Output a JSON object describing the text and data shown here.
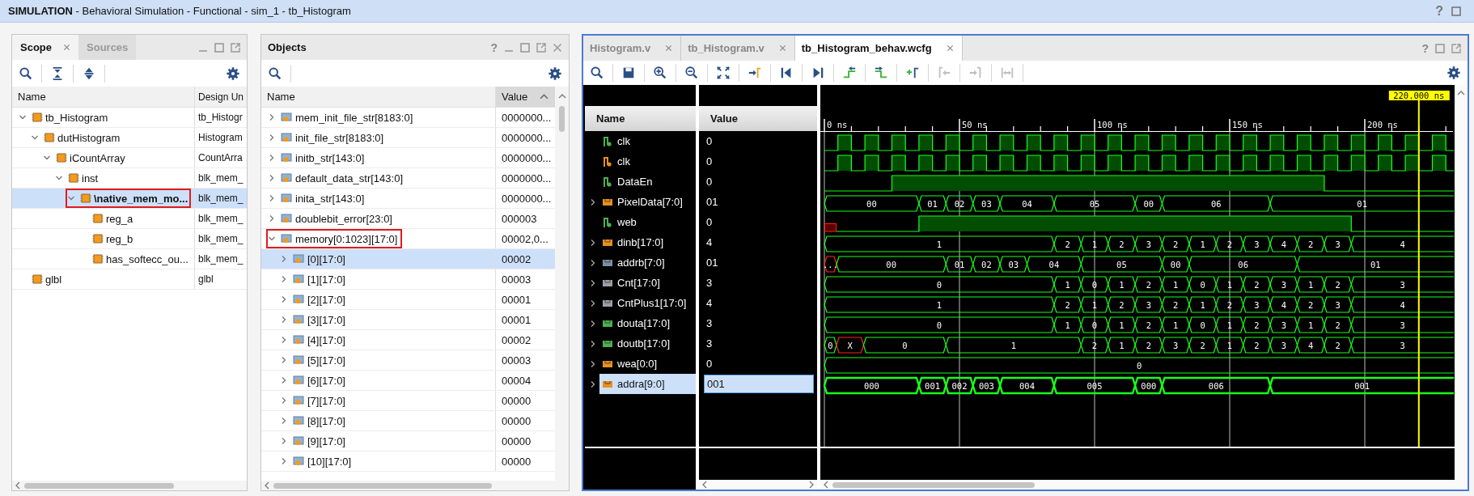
{
  "title_bar": {
    "title": "**SIMULATION** - Behavioral Simulation - Functional - sim_1 - tb_Histogram",
    "help": "?"
  },
  "scope_panel": {
    "tabs": [
      {
        "label": "Scope",
        "selected": true,
        "closable": true
      },
      {
        "label": "Sources",
        "selected": false,
        "closable": false
      }
    ],
    "toolbar": [
      {
        "kind": "search"
      },
      {
        "kind": "collapse"
      },
      {
        "kind": "expand"
      }
    ],
    "columns": [
      "Name",
      "Design Un"
    ],
    "tree": [
      {
        "name": "tb_Histogram",
        "design_unit": "tb_Histogr",
        "expanded": true,
        "selected": false,
        "highlighted": false,
        "children": [
          {
            "name": "dutHistogram",
            "design_unit": "Histogram",
            "expanded": true,
            "selected": false,
            "highlighted": false,
            "children": [
              {
                "name": "iCountArray",
                "design_unit": "CountArra",
                "expanded": true,
                "selected": false,
                "highlighted": false,
                "children": [
                  {
                    "name": "inst",
                    "design_unit": "blk_mem_",
                    "expanded": true,
                    "selected": false,
                    "highlighted": false,
                    "children": [
                      {
                        "name": "\\native_mem_mo...",
                        "design_unit": "blk_mem_",
                        "expanded": true,
                        "selected": true,
                        "highlighted": true,
                        "children": [
                          {
                            "name": "reg_a",
                            "design_unit": "blk_mem_",
                            "selected": false,
                            "highlighted": false
                          },
                          {
                            "name": "reg_b",
                            "design_unit": "blk_mem_",
                            "selected": false,
                            "highlighted": false
                          },
                          {
                            "name": "has_softecc_ou...",
                            "design_unit": "blk_mem_",
                            "selected": false,
                            "highlighted": false
                          }
                        ]
                      }
                    ]
                  }
                ]
              }
            ]
          }
        ]
      },
      {
        "name": "glbl",
        "design_unit": "glbl",
        "selected": false,
        "highlighted": false
      }
    ]
  },
  "objects_panel": {
    "title": "Objects",
    "help": "?",
    "toolbar": [
      {
        "kind": "search"
      }
    ],
    "columns": [
      {
        "label": "Name",
        "sorted": false
      },
      {
        "label": "Value",
        "sorted": true
      }
    ],
    "rows": [
      {
        "name": "mem_init_file_str[8183:0]",
        "value": "0000000...",
        "expanded": false,
        "selected": false,
        "highlighted": false
      },
      {
        "name": "init_file_str[8183:0]",
        "value": "0000000...",
        "expanded": false,
        "selected": false,
        "highlighted": false
      },
      {
        "name": "initb_str[143:0]",
        "value": "0000000...",
        "expanded": false,
        "selected": false,
        "highlighted": false
      },
      {
        "name": "default_data_str[143:0]",
        "value": "0000000...",
        "expanded": false,
        "selected": false,
        "highlighted": false
      },
      {
        "name": "inita_str[143:0]",
        "value": "0000000...",
        "expanded": false,
        "selected": false,
        "highlighted": false
      },
      {
        "name": "doublebit_error[23:0]",
        "value": "000003",
        "expanded": false,
        "selected": false,
        "highlighted": false
      },
      {
        "name": "memory[0:1023][17:0]",
        "value": "00002,0...",
        "expanded": true,
        "selected": false,
        "highlighted": true,
        "children": [
          {
            "name": "[0][17:0]",
            "value": "00002",
            "expanded": false,
            "selected": true,
            "highlighted": false
          },
          {
            "name": "[1][17:0]",
            "value": "00003",
            "expanded": false,
            "selected": false,
            "highlighted": false
          },
          {
            "name": "[2][17:0]",
            "value": "00001",
            "expanded": false,
            "selected": false,
            "highlighted": false
          },
          {
            "name": "[3][17:0]",
            "value": "00001",
            "expanded": false,
            "selected": false,
            "highlighted": false
          },
          {
            "name": "[4][17:0]",
            "value": "00002",
            "expanded": false,
            "selected": false,
            "highlighted": false
          },
          {
            "name": "[5][17:0]",
            "value": "00003",
            "expanded": false,
            "selected": false,
            "highlighted": false
          },
          {
            "name": "[6][17:0]",
            "value": "00004",
            "expanded": false,
            "selected": false,
            "highlighted": false
          },
          {
            "name": "[7][17:0]",
            "value": "00000",
            "expanded": false,
            "selected": false,
            "highlighted": false
          },
          {
            "name": "[8][17:0]",
            "value": "00000",
            "expanded": false,
            "selected": false,
            "highlighted": false
          },
          {
            "name": "[9][17:0]",
            "value": "00000",
            "expanded": false,
            "selected": false,
            "highlighted": false
          },
          {
            "name": "[10][17:0]",
            "value": "00000",
            "expanded": false,
            "selected": false,
            "highlighted": false
          }
        ]
      }
    ]
  },
  "wave_panel": {
    "help": "?",
    "tabs": [
      {
        "label": "Histogram.v",
        "selected": false
      },
      {
        "label": "tb_Histogram.v",
        "selected": false
      },
      {
        "label": "tb_Histogram_behav.wcfg",
        "selected": true
      }
    ],
    "toolbar": [
      {
        "kind": "search",
        "disabled": false
      },
      {
        "kind": "save",
        "disabled": false
      },
      {
        "kind": "zoomin",
        "disabled": false
      },
      {
        "kind": "zoomout",
        "disabled": false
      },
      {
        "kind": "fit",
        "disabled": false
      },
      {
        "kind": "cursor",
        "disabled": false
      },
      {
        "kind": "start",
        "disabled": false
      },
      {
        "kind": "end",
        "disabled": false
      },
      {
        "kind": "prevtrans",
        "disabled": false
      },
      {
        "kind": "nexttrans",
        "disabled": false
      },
      {
        "kind": "addmarker",
        "disabled": false
      },
      {
        "kind": "prevmarker",
        "disabled": true
      },
      {
        "kind": "nextmarker",
        "disabled": true
      },
      {
        "kind": "swap",
        "disabled": true
      }
    ],
    "columns": [
      "Name",
      "Value"
    ],
    "cursor": "220.000 ns",
    "ruler": [
      "0 ns",
      "50 ns",
      "100 ns",
      "150 ns",
      "200 ns"
    ],
    "signals": [
      {
        "name": "clk",
        "value": "0",
        "kind": "bit",
        "color": "#4caf50",
        "selected": false
      },
      {
        "name": "clk",
        "value": "0",
        "kind": "bit",
        "color": "#e8901c",
        "selected": false
      },
      {
        "name": "DataEn",
        "value": "0",
        "kind": "bit",
        "color": "#4caf50",
        "selected": false
      },
      {
        "name": "PixelData[7:0]",
        "value": "01",
        "kind": "bus",
        "color": "#e8901c",
        "selected": false,
        "expanded": false,
        "segments": [
          {
            "value": "00",
            "unknown": false
          },
          {
            "value": "01",
            "unknown": false
          },
          {
            "value": "02",
            "unknown": false
          },
          {
            "value": "03",
            "unknown": false
          },
          {
            "value": "04",
            "unknown": false
          },
          {
            "value": "05",
            "unknown": false
          },
          {
            "value": "00",
            "unknown": false
          },
          {
            "value": "06",
            "unknown": false
          },
          {
            "value": "01",
            "unknown": false
          }
        ]
      },
      {
        "name": "web",
        "value": "0",
        "kind": "bit",
        "color": "#4caf50",
        "selected": false
      },
      {
        "name": "dinb[17:0]",
        "value": "4",
        "kind": "bus",
        "color": "#e8901c",
        "selected": false,
        "expanded": false,
        "segments": [
          {
            "value": "1",
            "unknown": false
          },
          {
            "value": "2",
            "unknown": false
          },
          {
            "value": "1",
            "unknown": false
          },
          {
            "value": "2",
            "unknown": false
          },
          {
            "value": "3",
            "unknown": false
          },
          {
            "value": "2",
            "unknown": false
          },
          {
            "value": "1",
            "unknown": false
          },
          {
            "value": "2",
            "unknown": false
          },
          {
            "value": "3",
            "unknown": false
          },
          {
            "value": "4",
            "unknown": false
          },
          {
            "value": "2",
            "unknown": false
          },
          {
            "value": "3",
            "unknown": false
          },
          {
            "value": "4",
            "unknown": false
          }
        ]
      },
      {
        "name": "addrb[7:0]",
        "value": "01",
        "kind": "bus",
        "color": "#7a8fa8",
        "selected": false,
        "expanded": false,
        "segments": [
          {
            "value": "...",
            "unknown": true
          },
          {
            "value": "00",
            "unknown": false
          },
          {
            "value": "01",
            "unknown": false
          },
          {
            "value": "02",
            "unknown": false
          },
          {
            "value": "03",
            "unknown": false
          },
          {
            "value": "04",
            "unknown": false
          },
          {
            "value": "05",
            "unknown": false
          },
          {
            "value": "00",
            "unknown": false
          },
          {
            "value": "06",
            "unknown": false
          },
          {
            "value": "01",
            "unknown": false
          }
        ]
      },
      {
        "name": "Cnt[17:0]",
        "value": "3",
        "kind": "bus",
        "color": "#9aa0a6",
        "selected": false,
        "expanded": false,
        "segments": [
          {
            "value": "0",
            "unknown": false
          },
          {
            "value": "1",
            "unknown": false
          },
          {
            "value": "0",
            "unknown": false
          },
          {
            "value": "1",
            "unknown": false
          },
          {
            "value": "2",
            "unknown": false
          },
          {
            "value": "1",
            "unknown": false
          },
          {
            "value": "0",
            "unknown": false
          },
          {
            "value": "1",
            "unknown": false
          },
          {
            "value": "2",
            "unknown": false
          },
          {
            "value": "3",
            "unknown": false
          },
          {
            "value": "1",
            "unknown": false
          },
          {
            "value": "2",
            "unknown": false
          },
          {
            "value": "3",
            "unknown": false
          }
        ]
      },
      {
        "name": "CntPlus1[17:0]",
        "value": "4",
        "kind": "bus",
        "color": "#9aa0a6",
        "selected": false,
        "expanded": false,
        "segments": [
          {
            "value": "1",
            "unknown": false
          },
          {
            "value": "2",
            "unknown": false
          },
          {
            "value": "1",
            "unknown": false
          },
          {
            "value": "2",
            "unknown": false
          },
          {
            "value": "3",
            "unknown": false
          },
          {
            "value": "2",
            "unknown": false
          },
          {
            "value": "1",
            "unknown": false
          },
          {
            "value": "2",
            "unknown": false
          },
          {
            "value": "3",
            "unknown": false
          },
          {
            "value": "4",
            "unknown": false
          },
          {
            "value": "2",
            "unknown": false
          },
          {
            "value": "3",
            "unknown": false
          },
          {
            "value": "4",
            "unknown": false
          }
        ]
      },
      {
        "name": "douta[17:0]",
        "value": "3",
        "kind": "bus",
        "color": "#4caf50",
        "selected": false,
        "expanded": false,
        "segments": [
          {
            "value": "0",
            "unknown": false
          },
          {
            "value": "1",
            "unknown": false
          },
          {
            "value": "0",
            "unknown": false
          },
          {
            "value": "1",
            "unknown": false
          },
          {
            "value": "2",
            "unknown": false
          },
          {
            "value": "1",
            "unknown": false
          },
          {
            "value": "0",
            "unknown": false
          },
          {
            "value": "1",
            "unknown": false
          },
          {
            "value": "2",
            "unknown": false
          },
          {
            "value": "3",
            "unknown": false
          },
          {
            "value": "1",
            "unknown": false
          },
          {
            "value": "2",
            "unknown": false
          },
          {
            "value": "3",
            "unknown": false
          }
        ]
      },
      {
        "name": "doutb[17:0]",
        "value": "3",
        "kind": "bus",
        "color": "#4caf50",
        "selected": false,
        "expanded": false,
        "segments": [
          {
            "value": "0",
            "unknown": false
          },
          {
            "value": "X",
            "unknown": true
          },
          {
            "value": "0",
            "unknown": false
          },
          {
            "value": "1",
            "unknown": false
          },
          {
            "value": "2",
            "unknown": false
          },
          {
            "value": "1",
            "unknown": false
          },
          {
            "value": "2",
            "unknown": false
          },
          {
            "value": "3",
            "unknown": false
          },
          {
            "value": "2",
            "unknown": false
          },
          {
            "value": "1",
            "unknown": false
          },
          {
            "value": "2",
            "unknown": false
          },
          {
            "value": "3",
            "unknown": false
          },
          {
            "value": "4",
            "unknown": false
          },
          {
            "value": "2",
            "unknown": false
          },
          {
            "value": "3",
            "unknown": false
          }
        ]
      },
      {
        "name": "wea[0:0]",
        "value": "0",
        "kind": "bus",
        "color": "#e8901c",
        "selected": false,
        "expanded": false,
        "segments": [
          {
            "value": "0",
            "unknown": false
          }
        ]
      },
      {
        "name": "addra[9:0]",
        "value": "001",
        "kind": "bus",
        "color": "#e8901c",
        "selected": true,
        "expanded": false,
        "segments": [
          {
            "value": "000",
            "unknown": false
          },
          {
            "value": "001",
            "unknown": false
          },
          {
            "value": "002",
            "unknown": false
          },
          {
            "value": "003",
            "unknown": false
          },
          {
            "value": "004",
            "unknown": false
          },
          {
            "value": "005",
            "unknown": false
          },
          {
            "value": "000",
            "unknown": false
          },
          {
            "value": "006",
            "unknown": false
          },
          {
            "value": "001",
            "unknown": false
          }
        ]
      }
    ]
  }
}
